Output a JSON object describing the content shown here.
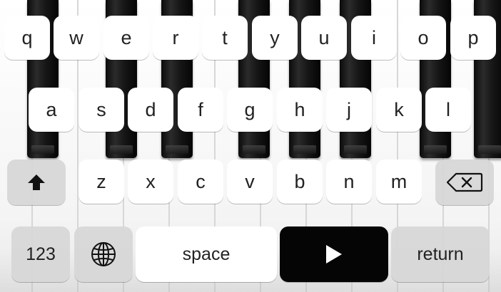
{
  "keyboard": {
    "row1": [
      "q",
      "w",
      "e",
      "r",
      "t",
      "y",
      "u",
      "i",
      "o",
      "p"
    ],
    "row2": [
      "a",
      "s",
      "d",
      "f",
      "g",
      "h",
      "j",
      "k",
      "l"
    ],
    "row3": [
      "z",
      "x",
      "c",
      "v",
      "b",
      "n",
      "m"
    ],
    "special": {
      "shift_icon": "shift-arrow-icon",
      "delete_icon": "backspace-icon",
      "numbers_label": "123",
      "globe_icon": "globe-icon",
      "space_label": "space",
      "play_icon": "play-icon",
      "return_label": "return"
    },
    "colors": {
      "key_white": "#ffffff",
      "key_special": "#d7d7d7",
      "play_key": "#050505"
    }
  }
}
